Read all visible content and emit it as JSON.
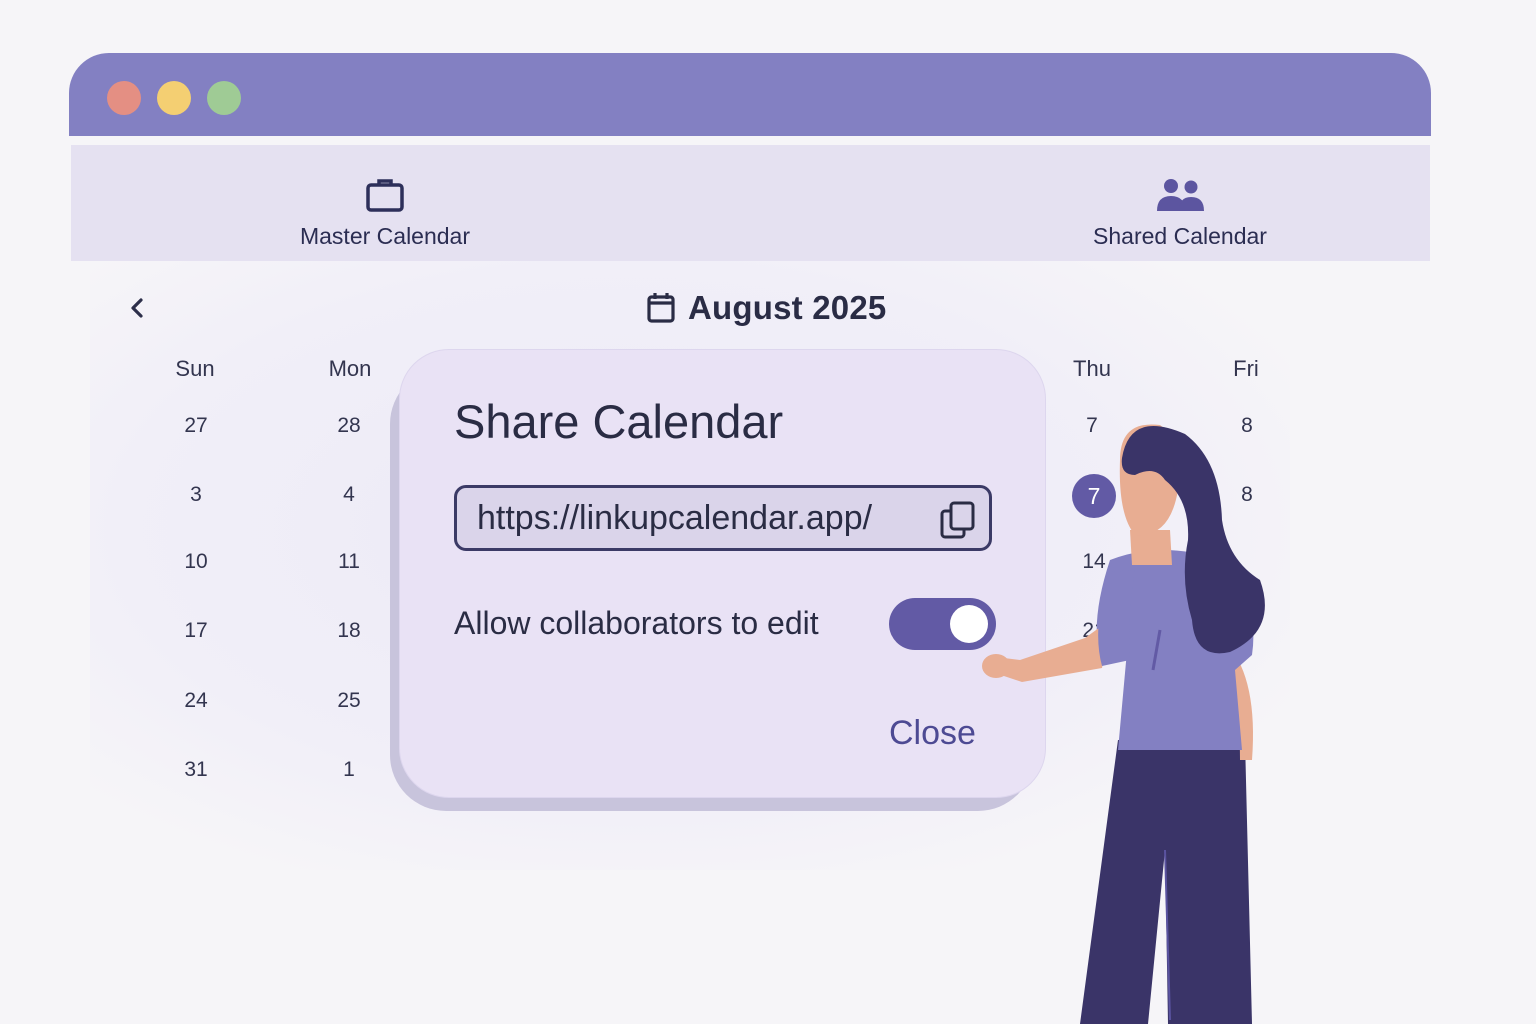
{
  "window": {
    "controls": [
      "close",
      "minimize",
      "maximize"
    ]
  },
  "tabs": [
    {
      "label": "Master Calendar",
      "icon": "briefcase-icon"
    },
    {
      "label": "Shared Calendar",
      "icon": "users-icon"
    }
  ],
  "calendar": {
    "month_title": "August 2025",
    "weekdays": {
      "sun": "Sun",
      "mon": "Mon",
      "thu": "Thu",
      "fri": "Fri"
    },
    "sun_column": [
      "27",
      "3",
      "10",
      "17",
      "24",
      "31"
    ],
    "mon_column": [
      "28",
      "4",
      "11",
      "18",
      "25",
      "1"
    ],
    "thu_column": [
      "7",
      "7",
      "14",
      "21"
    ],
    "fri_column": [
      "8",
      "8"
    ],
    "selected_day": "7"
  },
  "modal": {
    "title": "Share Calendar",
    "url": "https://linkupcalendar.app/",
    "toggle_label": "Allow collaborators to edit",
    "toggle_on": true,
    "close_label": "Close"
  },
  "colors": {
    "accent": "#625aa5",
    "titlebar": "#8380c2",
    "tabbar": "#e5e1f1",
    "modal_bg": "#e9e2f5"
  }
}
